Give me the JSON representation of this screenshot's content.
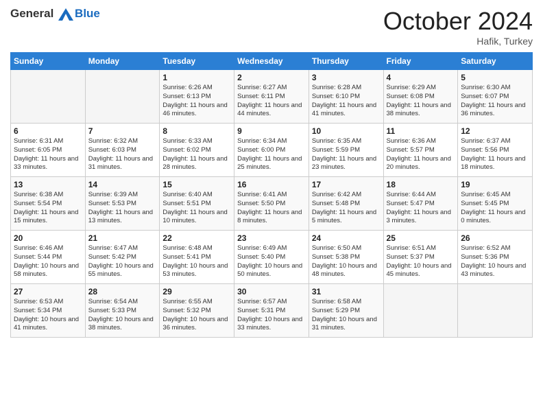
{
  "logo": {
    "general": "General",
    "blue": "Blue"
  },
  "header": {
    "month": "October 2024",
    "location": "Hafik, Turkey"
  },
  "days_of_week": [
    "Sunday",
    "Monday",
    "Tuesday",
    "Wednesday",
    "Thursday",
    "Friday",
    "Saturday"
  ],
  "weeks": [
    [
      {
        "day": "",
        "sunrise": "",
        "sunset": "",
        "daylight": ""
      },
      {
        "day": "",
        "sunrise": "",
        "sunset": "",
        "daylight": ""
      },
      {
        "day": "1",
        "sunrise": "Sunrise: 6:26 AM",
        "sunset": "Sunset: 6:13 PM",
        "daylight": "Daylight: 11 hours and 46 minutes."
      },
      {
        "day": "2",
        "sunrise": "Sunrise: 6:27 AM",
        "sunset": "Sunset: 6:11 PM",
        "daylight": "Daylight: 11 hours and 44 minutes."
      },
      {
        "day": "3",
        "sunrise": "Sunrise: 6:28 AM",
        "sunset": "Sunset: 6:10 PM",
        "daylight": "Daylight: 11 hours and 41 minutes."
      },
      {
        "day": "4",
        "sunrise": "Sunrise: 6:29 AM",
        "sunset": "Sunset: 6:08 PM",
        "daylight": "Daylight: 11 hours and 38 minutes."
      },
      {
        "day": "5",
        "sunrise": "Sunrise: 6:30 AM",
        "sunset": "Sunset: 6:07 PM",
        "daylight": "Daylight: 11 hours and 36 minutes."
      }
    ],
    [
      {
        "day": "6",
        "sunrise": "Sunrise: 6:31 AM",
        "sunset": "Sunset: 6:05 PM",
        "daylight": "Daylight: 11 hours and 33 minutes."
      },
      {
        "day": "7",
        "sunrise": "Sunrise: 6:32 AM",
        "sunset": "Sunset: 6:03 PM",
        "daylight": "Daylight: 11 hours and 31 minutes."
      },
      {
        "day": "8",
        "sunrise": "Sunrise: 6:33 AM",
        "sunset": "Sunset: 6:02 PM",
        "daylight": "Daylight: 11 hours and 28 minutes."
      },
      {
        "day": "9",
        "sunrise": "Sunrise: 6:34 AM",
        "sunset": "Sunset: 6:00 PM",
        "daylight": "Daylight: 11 hours and 25 minutes."
      },
      {
        "day": "10",
        "sunrise": "Sunrise: 6:35 AM",
        "sunset": "Sunset: 5:59 PM",
        "daylight": "Daylight: 11 hours and 23 minutes."
      },
      {
        "day": "11",
        "sunrise": "Sunrise: 6:36 AM",
        "sunset": "Sunset: 5:57 PM",
        "daylight": "Daylight: 11 hours and 20 minutes."
      },
      {
        "day": "12",
        "sunrise": "Sunrise: 6:37 AM",
        "sunset": "Sunset: 5:56 PM",
        "daylight": "Daylight: 11 hours and 18 minutes."
      }
    ],
    [
      {
        "day": "13",
        "sunrise": "Sunrise: 6:38 AM",
        "sunset": "Sunset: 5:54 PM",
        "daylight": "Daylight: 11 hours and 15 minutes."
      },
      {
        "day": "14",
        "sunrise": "Sunrise: 6:39 AM",
        "sunset": "Sunset: 5:53 PM",
        "daylight": "Daylight: 11 hours and 13 minutes."
      },
      {
        "day": "15",
        "sunrise": "Sunrise: 6:40 AM",
        "sunset": "Sunset: 5:51 PM",
        "daylight": "Daylight: 11 hours and 10 minutes."
      },
      {
        "day": "16",
        "sunrise": "Sunrise: 6:41 AM",
        "sunset": "Sunset: 5:50 PM",
        "daylight": "Daylight: 11 hours and 8 minutes."
      },
      {
        "day": "17",
        "sunrise": "Sunrise: 6:42 AM",
        "sunset": "Sunset: 5:48 PM",
        "daylight": "Daylight: 11 hours and 5 minutes."
      },
      {
        "day": "18",
        "sunrise": "Sunrise: 6:44 AM",
        "sunset": "Sunset: 5:47 PM",
        "daylight": "Daylight: 11 hours and 3 minutes."
      },
      {
        "day": "19",
        "sunrise": "Sunrise: 6:45 AM",
        "sunset": "Sunset: 5:45 PM",
        "daylight": "Daylight: 11 hours and 0 minutes."
      }
    ],
    [
      {
        "day": "20",
        "sunrise": "Sunrise: 6:46 AM",
        "sunset": "Sunset: 5:44 PM",
        "daylight": "Daylight: 10 hours and 58 minutes."
      },
      {
        "day": "21",
        "sunrise": "Sunrise: 6:47 AM",
        "sunset": "Sunset: 5:42 PM",
        "daylight": "Daylight: 10 hours and 55 minutes."
      },
      {
        "day": "22",
        "sunrise": "Sunrise: 6:48 AM",
        "sunset": "Sunset: 5:41 PM",
        "daylight": "Daylight: 10 hours and 53 minutes."
      },
      {
        "day": "23",
        "sunrise": "Sunrise: 6:49 AM",
        "sunset": "Sunset: 5:40 PM",
        "daylight": "Daylight: 10 hours and 50 minutes."
      },
      {
        "day": "24",
        "sunrise": "Sunrise: 6:50 AM",
        "sunset": "Sunset: 5:38 PM",
        "daylight": "Daylight: 10 hours and 48 minutes."
      },
      {
        "day": "25",
        "sunrise": "Sunrise: 6:51 AM",
        "sunset": "Sunset: 5:37 PM",
        "daylight": "Daylight: 10 hours and 45 minutes."
      },
      {
        "day": "26",
        "sunrise": "Sunrise: 6:52 AM",
        "sunset": "Sunset: 5:36 PM",
        "daylight": "Daylight: 10 hours and 43 minutes."
      }
    ],
    [
      {
        "day": "27",
        "sunrise": "Sunrise: 6:53 AM",
        "sunset": "Sunset: 5:34 PM",
        "daylight": "Daylight: 10 hours and 41 minutes."
      },
      {
        "day": "28",
        "sunrise": "Sunrise: 6:54 AM",
        "sunset": "Sunset: 5:33 PM",
        "daylight": "Daylight: 10 hours and 38 minutes."
      },
      {
        "day": "29",
        "sunrise": "Sunrise: 6:55 AM",
        "sunset": "Sunset: 5:32 PM",
        "daylight": "Daylight: 10 hours and 36 minutes."
      },
      {
        "day": "30",
        "sunrise": "Sunrise: 6:57 AM",
        "sunset": "Sunset: 5:31 PM",
        "daylight": "Daylight: 10 hours and 33 minutes."
      },
      {
        "day": "31",
        "sunrise": "Sunrise: 6:58 AM",
        "sunset": "Sunset: 5:29 PM",
        "daylight": "Daylight: 10 hours and 31 minutes."
      },
      {
        "day": "",
        "sunrise": "",
        "sunset": "",
        "daylight": ""
      },
      {
        "day": "",
        "sunrise": "",
        "sunset": "",
        "daylight": ""
      }
    ]
  ]
}
